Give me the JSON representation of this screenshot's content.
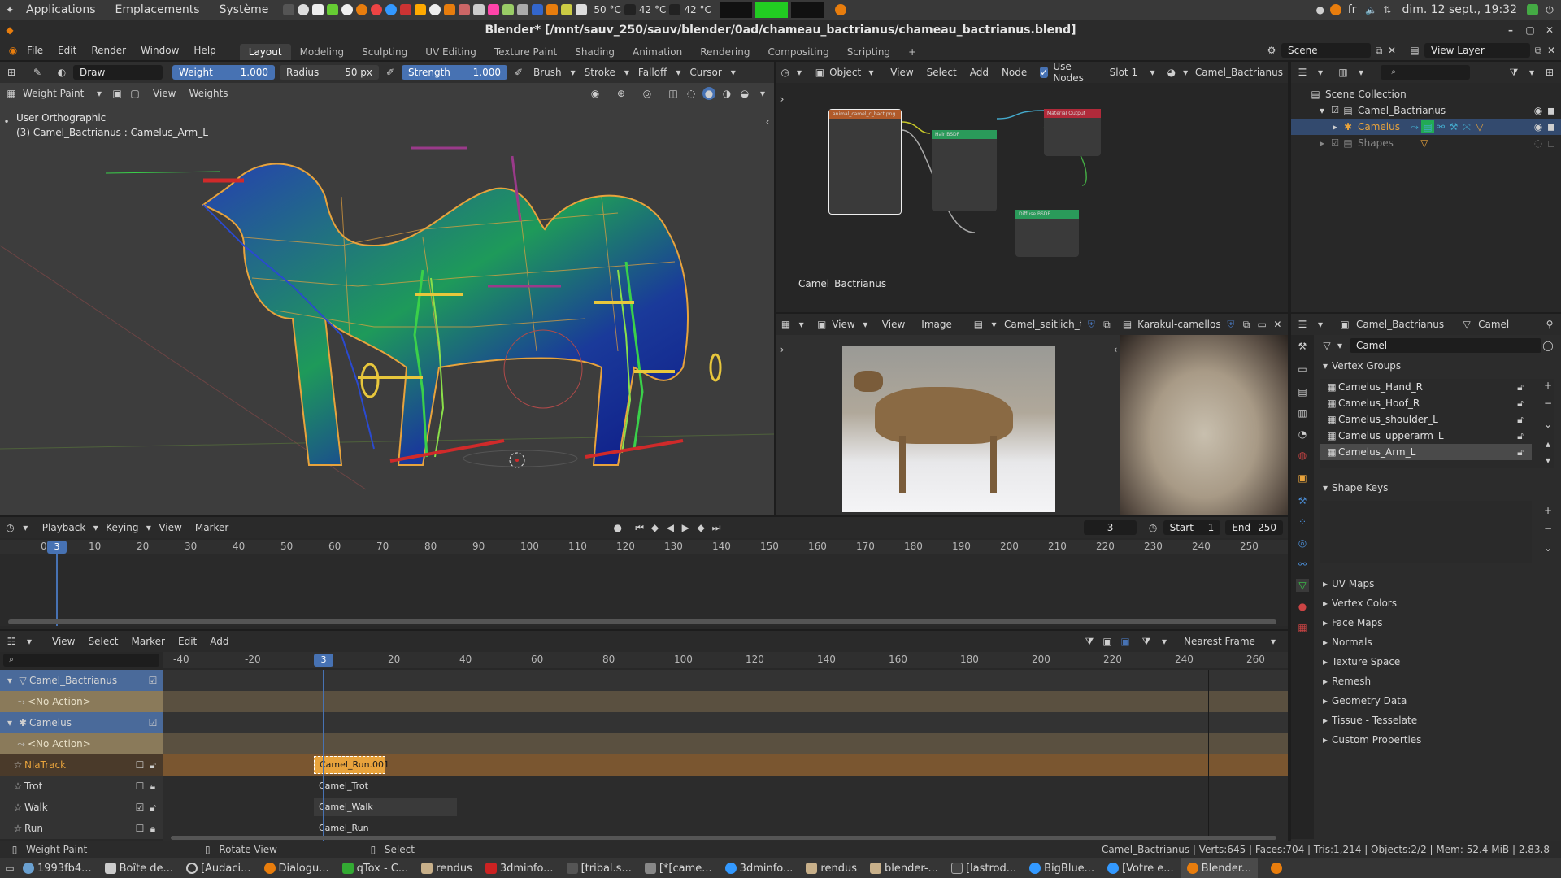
{
  "system_bar": {
    "menus": [
      "Applications",
      "Emplacements",
      "Système"
    ],
    "temps": [
      "50 °C",
      "42 °C",
      "42 °C"
    ],
    "lang": "fr",
    "datetime": "dim. 12 sept., 19:32"
  },
  "window": {
    "title": "Blender* [/mnt/sauv_250/sauv/blender/0ad/chameau_bactrianus/chameau_bactrianus.blend]"
  },
  "menu": {
    "items": [
      "File",
      "Edit",
      "Render",
      "Window",
      "Help"
    ],
    "workspaces": [
      "Layout",
      "Modeling",
      "Sculpting",
      "UV Editing",
      "Texture Paint",
      "Shading",
      "Animation",
      "Rendering",
      "Compositing",
      "Scripting"
    ],
    "active_workspace": "Layout",
    "scene_label": "Scene",
    "view_layer_label": "View Layer"
  },
  "viewport": {
    "tool": "Draw",
    "weight_label": "Weight",
    "weight_value": "1.000",
    "radius_label": "Radius",
    "radius_value": "50 px",
    "strength_label": "Strength",
    "strength_value": "1.000",
    "dropdowns": [
      "Brush",
      "Stroke",
      "Falloff",
      "Cursor"
    ],
    "mode": "Weight Paint",
    "menus": [
      "View",
      "Weights"
    ],
    "view_name": "User Orthographic",
    "object_info": "(3) Camel_Bactrianus : Camelus_Arm_L"
  },
  "node_editor": {
    "mode": "Object",
    "menus": [
      "View",
      "Select",
      "Add",
      "Node"
    ],
    "use_nodes_label": "Use Nodes",
    "slot": "Slot 1",
    "material": "Camel_Bactrianus",
    "footer_label": "Camel_Bactrianus",
    "nodes": {
      "image_texture": "animal_camel_c_bact.png",
      "principled": "Hair BSDF",
      "output": "Material Output",
      "diffuse": "Diffuse BSDF"
    }
  },
  "image_editors": {
    "menus": [
      "View",
      "View",
      "Image"
    ],
    "image1": "Camel_seitlich_trab...",
    "image2": "Karakul-camellos-d0..."
  },
  "outliner": {
    "root": "Scene Collection",
    "items": [
      {
        "label": "Camel_Bactrianus",
        "level": 1
      },
      {
        "label": "Camelus",
        "level": 2
      },
      {
        "label": "Shapes",
        "level": 1
      }
    ]
  },
  "properties": {
    "object_name": "Camel_Bactrianus",
    "data_name": "Camel",
    "mesh_field": "Camel",
    "vertex_groups_label": "Vertex Groups",
    "vertex_groups": [
      "Camelus_Hand_R",
      "Camelus_Hoof_R",
      "Camelus_shoulder_L",
      "Camelus_upperarm_L",
      "Camelus_Arm_L"
    ],
    "shape_keys_label": "Shape Keys",
    "sections": [
      "UV Maps",
      "Vertex Colors",
      "Face Maps",
      "Normals",
      "Texture Space",
      "Remesh",
      "Geometry Data",
      "Tissue - Tesselate",
      "Custom Properties"
    ]
  },
  "timeline": {
    "menus": [
      "Playback",
      "Keying",
      "View",
      "Marker"
    ],
    "current_frame": "3",
    "start_label": "Start",
    "start": "1",
    "end_label": "End",
    "end": "250",
    "ruler": [
      "0",
      "10",
      "20",
      "30",
      "40",
      "50",
      "60",
      "70",
      "80",
      "90",
      "100",
      "110",
      "120",
      "130",
      "140",
      "150",
      "160",
      "170",
      "180",
      "190",
      "200",
      "210",
      "220",
      "230",
      "240",
      "250"
    ]
  },
  "nla": {
    "menus": [
      "View",
      "Select",
      "Marker",
      "Edit",
      "Add"
    ],
    "snap": "Nearest Frame",
    "ruler": [
      "-40",
      "-20",
      "20",
      "40",
      "60",
      "80",
      "100",
      "120",
      "140",
      "160",
      "180",
      "200",
      "220",
      "240",
      "260"
    ],
    "playhead": "3",
    "tracks": [
      {
        "label": "Camel_Bactrianus",
        "type": "object"
      },
      {
        "label": "<No Action>",
        "type": "action"
      },
      {
        "label": "Camelus",
        "type": "object"
      },
      {
        "label": "<No Action>",
        "type": "action"
      },
      {
        "label": "NlaTrack",
        "type": "track",
        "strip": "Camel_Run.001"
      },
      {
        "label": "Trot",
        "type": "track",
        "strip": "Camel_Trot"
      },
      {
        "label": "Walk",
        "type": "track",
        "strip": "Camel_Walk"
      },
      {
        "label": "Run",
        "type": "track",
        "strip": "Camel_Run"
      }
    ]
  },
  "status": {
    "left": "Weight Paint",
    "middle": "Rotate View",
    "select": "Select",
    "right": "Camel_Bactrianus | Verts:645 | Faces:704 | Tris:1,214 | Objects:2/2 | Mem: 52.4 MiB | 2.83.8"
  },
  "taskbar": {
    "items": [
      "1993fb4...",
      "Boîte de...",
      "[Audaci...",
      "Dialogu...",
      "qTox - C...",
      "rendus",
      "3dminfo...",
      "[tribal.s...",
      "[*[came...",
      "3dminfo...",
      "rendus",
      "blender-...",
      "[lastrod...",
      "BigBlue...",
      "[Votre e...",
      "Blender..."
    ]
  },
  "colors": {
    "accent": "#4772b3",
    "orange": "#e8a33c",
    "nla_orange": "#c98a3b"
  }
}
